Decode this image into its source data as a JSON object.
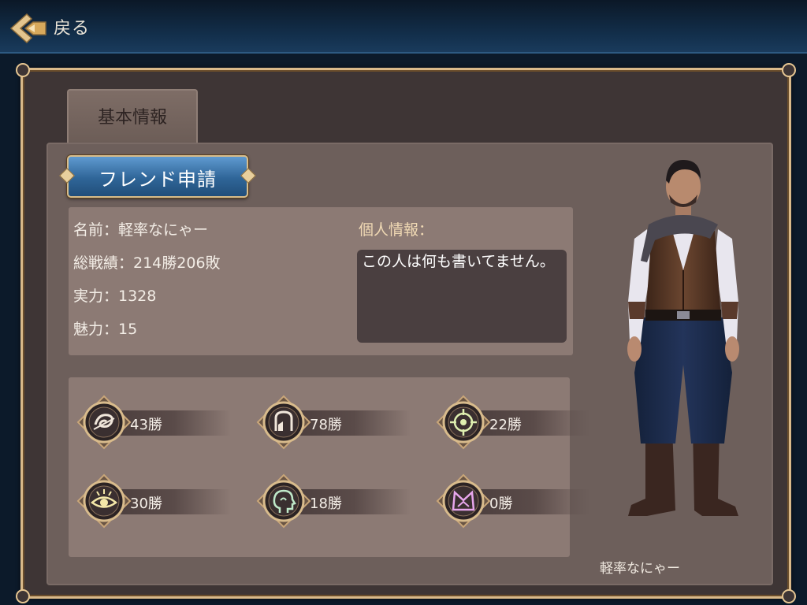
{
  "header": {
    "back_label": "戻る"
  },
  "tabs": [
    {
      "label": "基本情報",
      "selected": true
    }
  ],
  "friend_request_label": "フレンド申請",
  "profile": {
    "name_line": "名前：軽率なにゃー",
    "record_line": "総戦績：214勝206敗",
    "power_line": "実力：1328",
    "charm_line": "魅力：15",
    "personal_label": "個人情報：",
    "bio": "この人は何も書いてません。"
  },
  "stats": [
    {
      "icon": "swirl-rune-icon",
      "wins": "43勝"
    },
    {
      "icon": "hand-rune-icon",
      "wins": "78勝"
    },
    {
      "icon": "crosshair-rune-icon",
      "wins": "22勝"
    },
    {
      "icon": "eye-rune-icon",
      "wins": "30勝"
    },
    {
      "icon": "head-rune-icon",
      "wins": "18勝"
    },
    {
      "icon": "crown-rune-icon",
      "wins": "0勝"
    }
  ],
  "character": {
    "name": "軽率なにゃー"
  },
  "colors": {
    "frame_gold": "#d9b98a",
    "button_blue": "#2f6598",
    "panel": "#6d5f5b"
  }
}
